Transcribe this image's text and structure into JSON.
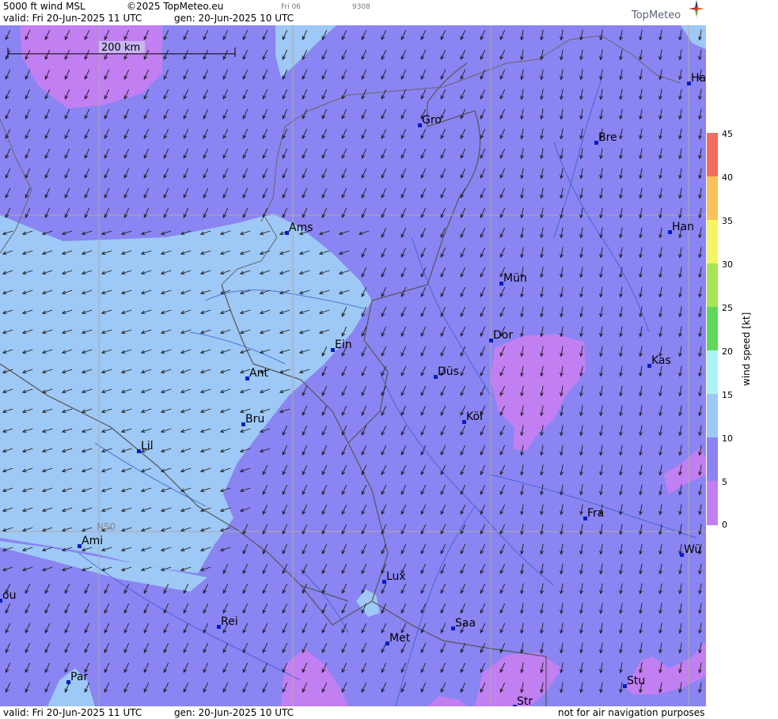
{
  "header": {
    "product": "5000 ft wind MSL",
    "copyright": "©2025 TopMeteo.eu",
    "valid": "valid:  Fri   20-Jun-2025   11 UTC",
    "gen": "gen:  20-Jun-2025  10 UTC",
    "slot": "Fri 06",
    "code": "9308",
    "logo": "TopMeteo"
  },
  "footer": {
    "valid": "valid:  Fri   20-Jun-2025   11 UTC",
    "gen": "gen:  20-Jun-2025  10 UTC",
    "disclaimer": "not for air navigation purposes"
  },
  "map": {
    "scale_label": "200 km",
    "latitude_label": "N50",
    "cities": [
      {
        "label": "Ha"
      },
      {
        "label": "Gro"
      },
      {
        "label": "Bre"
      },
      {
        "label": "Ams"
      },
      {
        "label": "Han"
      },
      {
        "label": "Mün"
      },
      {
        "label": "Ein"
      },
      {
        "label": "Dor"
      },
      {
        "label": "Kas"
      },
      {
        "label": "Ant"
      },
      {
        "label": "Düs"
      },
      {
        "label": "Bru"
      },
      {
        "label": "Köl"
      },
      {
        "label": "Lil"
      },
      {
        "label": "Fra"
      },
      {
        "label": "Ami"
      },
      {
        "label": "Wü"
      },
      {
        "label": "ou"
      },
      {
        "label": "Lux"
      },
      {
        "label": "Rei"
      },
      {
        "label": "Saa"
      },
      {
        "label": "Met"
      },
      {
        "label": "Par"
      },
      {
        "label": "Stu"
      },
      {
        "label": "Str"
      }
    ]
  },
  "legend": {
    "title": "wind speed [kt]",
    "ticks": [
      "45",
      "40",
      "35",
      "30",
      "25",
      "20",
      "15",
      "10",
      "5",
      "0"
    ],
    "colors": [
      "#f26c5e",
      "#f7955c",
      "#fbc15a",
      "#f5f562",
      "#a6e655",
      "#5fd85a",
      "#aef3f3",
      "#9ec8f5",
      "#8a85f2",
      "#c27ff2"
    ]
  }
}
